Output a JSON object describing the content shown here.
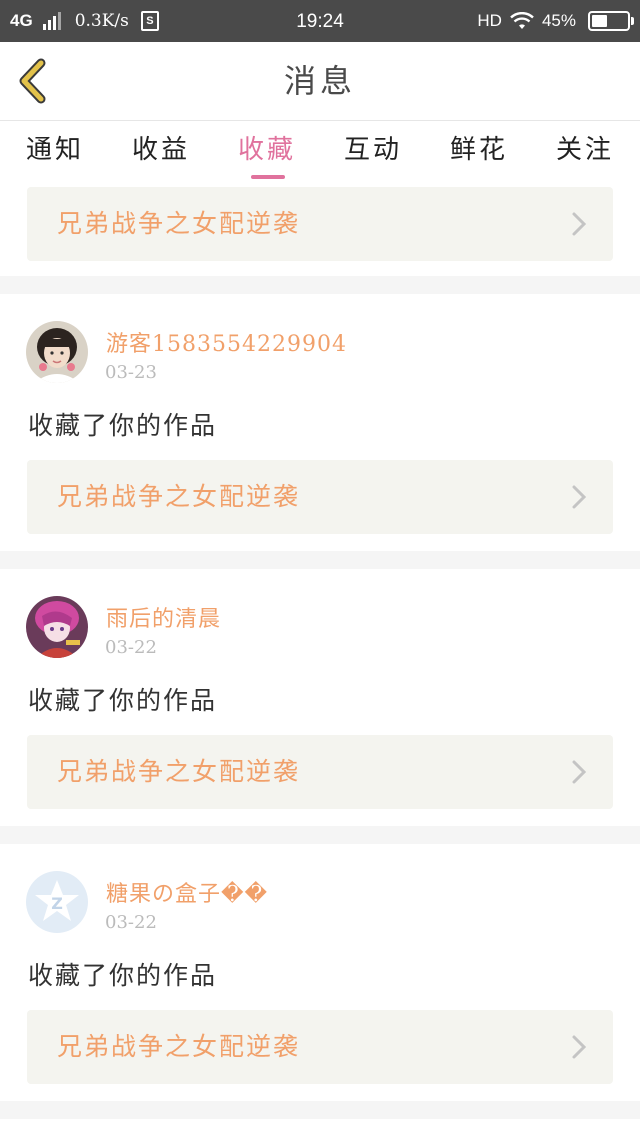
{
  "status_bar": {
    "network": "4G",
    "speed": "0.3K/s",
    "time": "19:24",
    "hd": "HD",
    "battery_text": "45%",
    "battery_level_percent": 45
  },
  "header": {
    "title": "消息",
    "back_icon": "chevron-left-icon",
    "accent_color": "#e3c24a"
  },
  "tabs": [
    {
      "label": "通知",
      "active": false
    },
    {
      "label": "收益",
      "active": false
    },
    {
      "label": "收藏",
      "active": true
    },
    {
      "label": "互动",
      "active": false
    },
    {
      "label": "鲜花",
      "active": false
    },
    {
      "label": "关注",
      "active": false
    }
  ],
  "colors": {
    "active_tab": "#e0729d",
    "username": "#f1a06a",
    "book_title": "#f1a06a",
    "card_bg": "#f4f4ef"
  },
  "top_card": {
    "book_title": "兄弟战争之女配逆袭"
  },
  "messages": [
    {
      "username": "游客1583554229904",
      "date": "03-23",
      "action": "收藏了你的作品",
      "book_title": "兄弟战争之女配逆袭",
      "avatar": "photo-avatar"
    },
    {
      "username": "雨后的清晨",
      "date": "03-22",
      "action": "收藏了你的作品",
      "book_title": "兄弟战争之女配逆袭",
      "avatar": "anime-avatar"
    },
    {
      "username": "糖果の盒子��",
      "date": "03-22",
      "action": "收藏了你的作品",
      "book_title": "兄弟战争之女配逆袭",
      "avatar": "default-z-avatar"
    }
  ]
}
